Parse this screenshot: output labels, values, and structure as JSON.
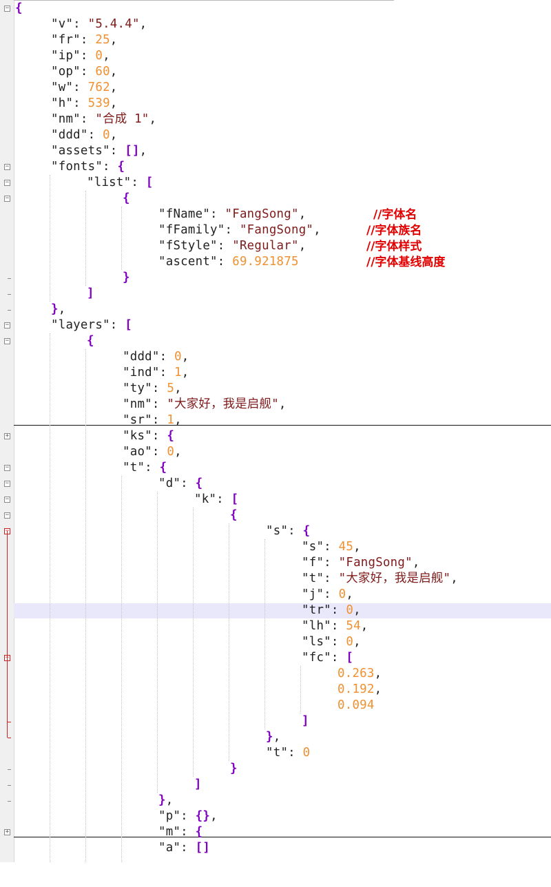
{
  "editor": {
    "lines": [
      {
        "indent": 0,
        "tokens": [
          {
            "t": "p",
            "v": "{"
          }
        ]
      },
      {
        "indent": 1,
        "tokens": [
          {
            "t": "k",
            "v": "\"v\""
          },
          {
            "t": "k",
            "v": ": "
          },
          {
            "t": "s",
            "v": "\"5.4.4\""
          },
          {
            "t": "k",
            "v": ","
          }
        ]
      },
      {
        "indent": 1,
        "tokens": [
          {
            "t": "k",
            "v": "\"fr\""
          },
          {
            "t": "k",
            "v": ": "
          },
          {
            "t": "n",
            "v": "25"
          },
          {
            "t": "k",
            "v": ","
          }
        ]
      },
      {
        "indent": 1,
        "tokens": [
          {
            "t": "k",
            "v": "\"ip\""
          },
          {
            "t": "k",
            "v": ": "
          },
          {
            "t": "n",
            "v": "0"
          },
          {
            "t": "k",
            "v": ","
          }
        ]
      },
      {
        "indent": 1,
        "tokens": [
          {
            "t": "k",
            "v": "\"op\""
          },
          {
            "t": "k",
            "v": ": "
          },
          {
            "t": "n",
            "v": "60"
          },
          {
            "t": "k",
            "v": ","
          }
        ]
      },
      {
        "indent": 1,
        "tokens": [
          {
            "t": "k",
            "v": "\"w\""
          },
          {
            "t": "k",
            "v": ": "
          },
          {
            "t": "n",
            "v": "762"
          },
          {
            "t": "k",
            "v": ","
          }
        ]
      },
      {
        "indent": 1,
        "tokens": [
          {
            "t": "k",
            "v": "\"h\""
          },
          {
            "t": "k",
            "v": ": "
          },
          {
            "t": "n",
            "v": "539"
          },
          {
            "t": "k",
            "v": ","
          }
        ]
      },
      {
        "indent": 1,
        "tokens": [
          {
            "t": "k",
            "v": "\"nm\""
          },
          {
            "t": "k",
            "v": ": "
          },
          {
            "t": "s",
            "v": "\"合成 1\""
          },
          {
            "t": "k",
            "v": ","
          }
        ]
      },
      {
        "indent": 1,
        "tokens": [
          {
            "t": "k",
            "v": "\"ddd\""
          },
          {
            "t": "k",
            "v": ": "
          },
          {
            "t": "n",
            "v": "0"
          },
          {
            "t": "k",
            "v": ","
          }
        ]
      },
      {
        "indent": 1,
        "tokens": [
          {
            "t": "k",
            "v": "\"assets\""
          },
          {
            "t": "k",
            "v": ": "
          },
          {
            "t": "p",
            "v": "[]"
          },
          {
            "t": "k",
            "v": ","
          }
        ]
      },
      {
        "indent": 1,
        "tokens": [
          {
            "t": "k",
            "v": "\"fonts\""
          },
          {
            "t": "k",
            "v": ": "
          },
          {
            "t": "p",
            "v": "{"
          }
        ]
      },
      {
        "indent": 2,
        "tokens": [
          {
            "t": "k",
            "v": "\"list\""
          },
          {
            "t": "k",
            "v": ": "
          },
          {
            "t": "p",
            "v": "["
          }
        ]
      },
      {
        "indent": 3,
        "tokens": [
          {
            "t": "p",
            "v": "{"
          }
        ]
      },
      {
        "indent": 4,
        "tokens": [
          {
            "t": "k",
            "v": "\"fName\""
          },
          {
            "t": "k",
            "v": ": "
          },
          {
            "t": "s",
            "v": "\"FangSong\""
          },
          {
            "t": "k",
            "v": ","
          }
        ]
      },
      {
        "indent": 4,
        "tokens": [
          {
            "t": "k",
            "v": "\"fFamily\""
          },
          {
            "t": "k",
            "v": ": "
          },
          {
            "t": "s",
            "v": "\"FangSong\""
          },
          {
            "t": "k",
            "v": ","
          }
        ]
      },
      {
        "indent": 4,
        "tokens": [
          {
            "t": "k",
            "v": "\"fStyle\""
          },
          {
            "t": "k",
            "v": ": "
          },
          {
            "t": "s",
            "v": "\"Regular\""
          },
          {
            "t": "k",
            "v": ","
          }
        ]
      },
      {
        "indent": 4,
        "tokens": [
          {
            "t": "k",
            "v": "\"ascent\""
          },
          {
            "t": "k",
            "v": ": "
          },
          {
            "t": "n",
            "v": "69.921875"
          }
        ]
      },
      {
        "indent": 3,
        "tokens": [
          {
            "t": "p",
            "v": "}"
          }
        ]
      },
      {
        "indent": 2,
        "tokens": [
          {
            "t": "p",
            "v": "]"
          }
        ]
      },
      {
        "indent": 1,
        "tokens": [
          {
            "t": "p",
            "v": "}"
          },
          {
            "t": "k",
            "v": ","
          }
        ]
      },
      {
        "indent": 1,
        "tokens": [
          {
            "t": "k",
            "v": "\"layers\""
          },
          {
            "t": "k",
            "v": ": "
          },
          {
            "t": "p",
            "v": "["
          }
        ]
      },
      {
        "indent": 2,
        "tokens": [
          {
            "t": "p",
            "v": "{"
          }
        ]
      },
      {
        "indent": 3,
        "tokens": [
          {
            "t": "k",
            "v": "\"ddd\""
          },
          {
            "t": "k",
            "v": ": "
          },
          {
            "t": "n",
            "v": "0"
          },
          {
            "t": "k",
            "v": ","
          }
        ]
      },
      {
        "indent": 3,
        "tokens": [
          {
            "t": "k",
            "v": "\"ind\""
          },
          {
            "t": "k",
            "v": ": "
          },
          {
            "t": "n",
            "v": "1"
          },
          {
            "t": "k",
            "v": ","
          }
        ]
      },
      {
        "indent": 3,
        "tokens": [
          {
            "t": "k",
            "v": "\"ty\""
          },
          {
            "t": "k",
            "v": ": "
          },
          {
            "t": "n",
            "v": "5"
          },
          {
            "t": "k",
            "v": ","
          }
        ]
      },
      {
        "indent": 3,
        "tokens": [
          {
            "t": "k",
            "v": "\"nm\""
          },
          {
            "t": "k",
            "v": ": "
          },
          {
            "t": "s",
            "v": "\"大家好，我是启舰\""
          },
          {
            "t": "k",
            "v": ","
          }
        ]
      },
      {
        "indent": 3,
        "tokens": [
          {
            "t": "k",
            "v": "\"sr\""
          },
          {
            "t": "k",
            "v": ": "
          },
          {
            "t": "n",
            "v": "1"
          },
          {
            "t": "k",
            "v": ","
          }
        ]
      },
      {
        "indent": 3,
        "tokens": [
          {
            "t": "k",
            "v": "\"ks\""
          },
          {
            "t": "k",
            "v": ": "
          },
          {
            "t": "p",
            "v": "{"
          }
        ]
      },
      {
        "indent": 3,
        "tokens": [
          {
            "t": "k",
            "v": "\"ao\""
          },
          {
            "t": "k",
            "v": ": "
          },
          {
            "t": "n",
            "v": "0"
          },
          {
            "t": "k",
            "v": ","
          }
        ]
      },
      {
        "indent": 3,
        "tokens": [
          {
            "t": "k",
            "v": "\"t\""
          },
          {
            "t": "k",
            "v": ": "
          },
          {
            "t": "p",
            "v": "{"
          }
        ]
      },
      {
        "indent": 4,
        "tokens": [
          {
            "t": "k",
            "v": "\"d\""
          },
          {
            "t": "k",
            "v": ": "
          },
          {
            "t": "p",
            "v": "{"
          }
        ]
      },
      {
        "indent": 5,
        "tokens": [
          {
            "t": "k",
            "v": "\"k\""
          },
          {
            "t": "k",
            "v": ": "
          },
          {
            "t": "p",
            "v": "["
          }
        ]
      },
      {
        "indent": 6,
        "tokens": [
          {
            "t": "p",
            "v": "{"
          }
        ]
      },
      {
        "indent": 7,
        "tokens": [
          {
            "t": "k",
            "v": "\"s\""
          },
          {
            "t": "k",
            "v": ": "
          },
          {
            "t": "p",
            "v": "{"
          }
        ]
      },
      {
        "indent": 8,
        "tokens": [
          {
            "t": "k",
            "v": "\"s\""
          },
          {
            "t": "k",
            "v": ": "
          },
          {
            "t": "n",
            "v": "45"
          },
          {
            "t": "k",
            "v": ","
          }
        ]
      },
      {
        "indent": 8,
        "tokens": [
          {
            "t": "k",
            "v": "\"f\""
          },
          {
            "t": "k",
            "v": ": "
          },
          {
            "t": "s",
            "v": "\"FangSong\""
          },
          {
            "t": "k",
            "v": ","
          }
        ]
      },
      {
        "indent": 8,
        "tokens": [
          {
            "t": "k",
            "v": "\"t\""
          },
          {
            "t": "k",
            "v": ": "
          },
          {
            "t": "s",
            "v": "\"大家好，我是启舰\""
          },
          {
            "t": "k",
            "v": ","
          }
        ]
      },
      {
        "indent": 8,
        "tokens": [
          {
            "t": "k",
            "v": "\"j\""
          },
          {
            "t": "k",
            "v": ": "
          },
          {
            "t": "n",
            "v": "0"
          },
          {
            "t": "k",
            "v": ","
          }
        ]
      },
      {
        "indent": 8,
        "tokens": [
          {
            "t": "k",
            "v": "\"tr\""
          },
          {
            "t": "k",
            "v": ": "
          },
          {
            "t": "n",
            "v": "0"
          },
          {
            "t": "k",
            "v": ","
          }
        ]
      },
      {
        "indent": 8,
        "tokens": [
          {
            "t": "k",
            "v": "\"lh\""
          },
          {
            "t": "k",
            "v": ": "
          },
          {
            "t": "n",
            "v": "54"
          },
          {
            "t": "k",
            "v": ","
          }
        ]
      },
      {
        "indent": 8,
        "tokens": [
          {
            "t": "k",
            "v": "\"ls\""
          },
          {
            "t": "k",
            "v": ": "
          },
          {
            "t": "n",
            "v": "0"
          },
          {
            "t": "k",
            "v": ","
          }
        ]
      },
      {
        "indent": 8,
        "tokens": [
          {
            "t": "k",
            "v": "\"fc\""
          },
          {
            "t": "k",
            "v": ": "
          },
          {
            "t": "p",
            "v": "["
          }
        ]
      },
      {
        "indent": 9,
        "tokens": [
          {
            "t": "n",
            "v": "0.263"
          },
          {
            "t": "k",
            "v": ","
          }
        ]
      },
      {
        "indent": 9,
        "tokens": [
          {
            "t": "n",
            "v": "0.192"
          },
          {
            "t": "k",
            "v": ","
          }
        ]
      },
      {
        "indent": 9,
        "tokens": [
          {
            "t": "n",
            "v": "0.094"
          }
        ]
      },
      {
        "indent": 8,
        "tokens": [
          {
            "t": "p",
            "v": "]"
          }
        ]
      },
      {
        "indent": 7,
        "tokens": [
          {
            "t": "p",
            "v": "}"
          },
          {
            "t": "k",
            "v": ","
          }
        ]
      },
      {
        "indent": 7,
        "tokens": [
          {
            "t": "k",
            "v": "\"t\""
          },
          {
            "t": "k",
            "v": ": "
          },
          {
            "t": "n",
            "v": "0"
          }
        ]
      },
      {
        "indent": 6,
        "tokens": [
          {
            "t": "p",
            "v": "}"
          }
        ]
      },
      {
        "indent": 5,
        "tokens": [
          {
            "t": "p",
            "v": "]"
          }
        ]
      },
      {
        "indent": 4,
        "tokens": [
          {
            "t": "p",
            "v": "}"
          },
          {
            "t": "k",
            "v": ","
          }
        ]
      },
      {
        "indent": 4,
        "tokens": [
          {
            "t": "k",
            "v": "\"p\""
          },
          {
            "t": "k",
            "v": ": "
          },
          {
            "t": "p",
            "v": "{}"
          },
          {
            "t": "k",
            "v": ","
          }
        ]
      },
      {
        "indent": 4,
        "tokens": [
          {
            "t": "k",
            "v": "\"m\""
          },
          {
            "t": "k",
            "v": ": "
          },
          {
            "t": "p",
            "v": "{"
          }
        ]
      },
      {
        "indent": 4,
        "tokens": [
          {
            "t": "k",
            "v": "\"a\""
          },
          {
            "t": "k",
            "v": ": "
          },
          {
            "t": "p",
            "v": "[]"
          }
        ]
      }
    ],
    "comments": [
      {
        "line": 13,
        "text": "//字体名"
      },
      {
        "line": 14,
        "text": "//字体族名"
      },
      {
        "line": 15,
        "text": "//字体样式"
      },
      {
        "line": 16,
        "text": "//字体基线高度"
      }
    ],
    "folds": {
      "open": [
        0,
        10,
        11,
        12,
        20,
        21,
        29,
        30,
        31,
        32
      ],
      "open_red": [
        33,
        41
      ],
      "collapsed": [
        27,
        52
      ],
      "ends": [
        17,
        18,
        19,
        48,
        49,
        50
      ],
      "ends_red": [
        45,
        46
      ],
      "red_bar_lines": [
        33,
        46
      ]
    },
    "highlighted_line": 38,
    "collapsed_separator_lines": [
      27,
      53
    ],
    "colors": {
      "key": "#222222",
      "string": "#7f1a1a",
      "number": "#f09030",
      "bracket": "#8000c0",
      "comment": "#e00000",
      "current_line": "#e8e8fa",
      "fold_red": "#cc2020"
    }
  }
}
